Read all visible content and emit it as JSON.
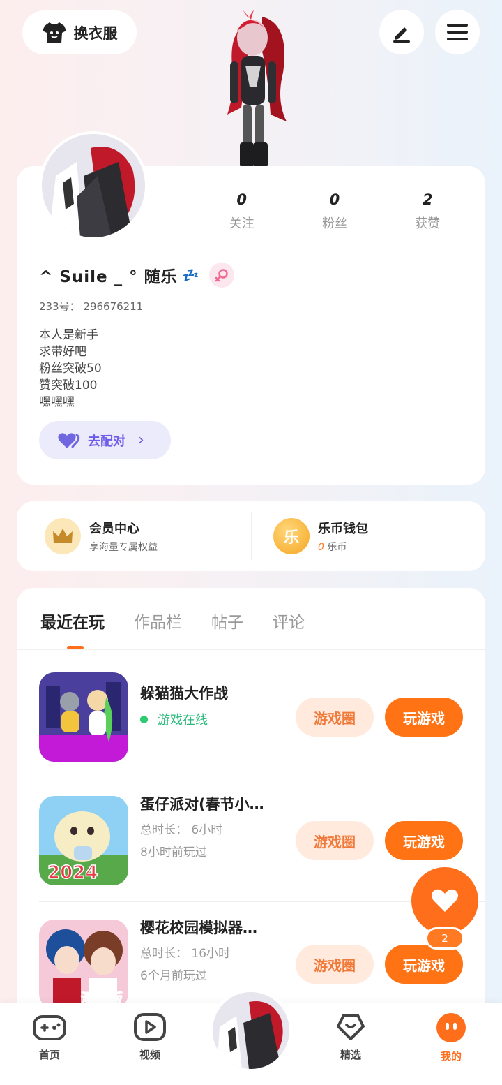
{
  "top_bar": {
    "outfit_label": "换衣服",
    "edit_icon": "pencil-icon",
    "menu_icon": "hamburger-icon"
  },
  "profile": {
    "stats": [
      {
        "value": "0",
        "label": "关注"
      },
      {
        "value": "0",
        "label": "粉丝"
      },
      {
        "value": "2",
        "label": "获赞"
      }
    ],
    "nickname": "^ Suile _ °  随乐",
    "sleep_emoji": "💤",
    "uid": "233号： 296676211",
    "bio": [
      "本人是新手",
      "求带好吧",
      "粉丝突破50",
      "赞突破100",
      "嘿嘿嘿"
    ],
    "match_label": "去配对"
  },
  "member": {
    "vip_title": "会员中心",
    "vip_sub": "享海量专属权益",
    "wallet_title": "乐币钱包",
    "wallet_amount": "0",
    "wallet_unit": "乐币",
    "wallet_coin_char": "乐"
  },
  "tabs": [
    "最近在玩",
    "作品栏",
    "帖子",
    "评论"
  ],
  "games": [
    {
      "name": "躲猫猫大作战",
      "status": "游戏在线",
      "circle": "游戏圈",
      "play": "玩游戏"
    },
    {
      "name": "蛋仔派对(春节小…",
      "duration": "总时长： 6小时",
      "last_played": "8小时前玩过",
      "circle": "游戏圈",
      "play": "玩游戏",
      "thumb_text": "2024"
    },
    {
      "name": "樱花校园模拟器…",
      "duration": "总时长： 16小时",
      "last_played": "6个月前玩过",
      "circle": "游戏圈",
      "play": "玩游戏",
      "thumb_text": "测试版"
    }
  ],
  "fav": {
    "count": "2"
  },
  "nav": [
    {
      "label": "首页",
      "icon": "gamepad-icon"
    },
    {
      "label": "视频",
      "icon": "video-icon"
    },
    {
      "label": "精选",
      "icon": "heart-chat-icon"
    },
    {
      "label": "我的",
      "icon": "profile-face-icon"
    }
  ],
  "colors": {
    "accent": "#ff6e1a",
    "purple": "#6c5ce7",
    "online": "#27b97a"
  }
}
